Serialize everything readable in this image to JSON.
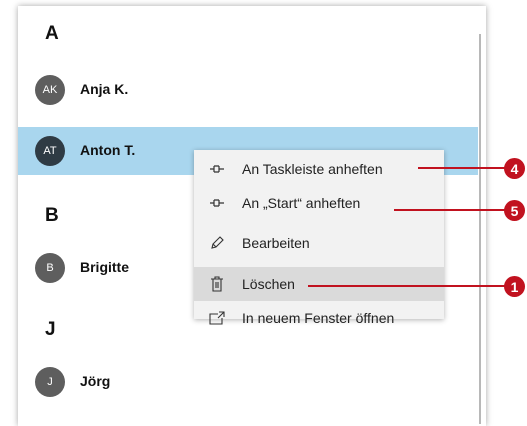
{
  "contacts": {
    "group_a": "A",
    "group_b": "B",
    "group_j": "J",
    "anja": {
      "initials": "AK",
      "name": "Anja K."
    },
    "anton": {
      "initials": "AT",
      "name": "Anton T."
    },
    "brigitte": {
      "initials": "B",
      "name": "Brigitte"
    },
    "joerg": {
      "initials": "J",
      "name": "Jörg"
    }
  },
  "context_menu": {
    "items": [
      {
        "label": "An Taskleiste anheften",
        "icon": "pin-icon"
      },
      {
        "label": "An „Start“ anheften",
        "icon": "pin-icon"
      },
      {
        "label": "Bearbeiten",
        "icon": "pencil-icon"
      },
      {
        "label": "Löschen",
        "icon": "trash-icon"
      },
      {
        "label": "In neuem Fenster öffnen",
        "icon": "open-window-icon"
      }
    ]
  },
  "callouts": {
    "taskbar": "4",
    "start": "5",
    "delete": "1"
  },
  "colors": {
    "selection": "#a9d6ee",
    "callout": "#c1121f",
    "menu_bg": "#f2f2f2",
    "menu_hover": "#dadada"
  }
}
